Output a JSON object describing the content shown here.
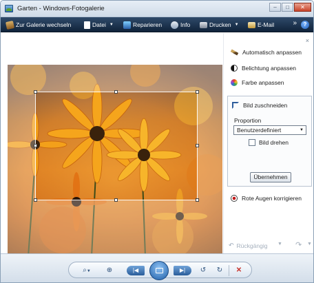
{
  "window": {
    "title": "Garten - Windows-Fotogalerie",
    "minimize": "–",
    "maximize": "□",
    "close": "✕"
  },
  "toolbar": {
    "gallery": "Zur Galerie wechseln",
    "file": "Datei",
    "fix": "Reparieren",
    "info": "Info",
    "print": "Drucken",
    "email": "E-Mail",
    "more": "»",
    "help": "?"
  },
  "panel": {
    "close": "×",
    "auto_adjust": "Automatisch anpassen",
    "exposure": "Belichtung anpassen",
    "color": "Farbe anpassen",
    "crop": {
      "title": "Bild zuschneiden",
      "proportion_label": "Proportion",
      "proportion_value": "Benutzerdefiniert",
      "rotate": "Bild drehen",
      "apply": "Übernehmen"
    },
    "redeye": "Rote Augen korrigieren",
    "undo": "Rückgängig"
  },
  "bottom": {
    "zoom_icon": "⌕",
    "fit_icon": "⊕",
    "prev_icon": "|◀",
    "next_icon": "▶|",
    "rotate_left_icon": "↺",
    "rotate_right_icon": "↻",
    "delete_icon": "✕"
  },
  "colors": {
    "toolbar_bg": "#1b2f48",
    "accent": "#2a5d9a",
    "delete": "#c8322a"
  }
}
